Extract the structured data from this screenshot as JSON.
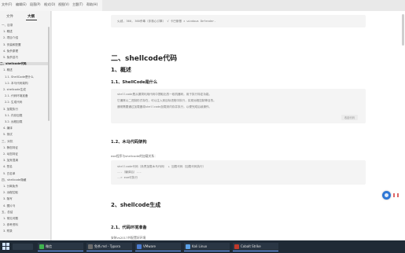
{
  "menubar": {
    "items": [
      "文件(F)",
      "编辑(E)",
      "段落(P)",
      "格式(O)",
      "视图(V)",
      "主题(T)",
      "帮助(H)"
    ]
  },
  "sidebar": {
    "tabs": [
      "文件",
      "大纲"
    ],
    "items": [
      "一、目录",
      "1. 概述",
      "2. 项目介绍",
      "3. 安装和配置",
      "4. 免杀原理",
      "5. 免杀技巧",
      "二、shellcode代码",
      "1. 概述",
      "1.1. ShellCode是什么",
      "1.2. 本马代码架构",
      "2. shellcode生成",
      "2.1. 代码环境准备",
      "2.2. 生成代码",
      "3. 加载执行",
      "3.1. 内存加载",
      "3.2. 远程加载",
      "4. 编译",
      "5. 测试",
      "三、对抗",
      "1. 静态特征",
      "2. 动态特征",
      "3. 加壳混淆",
      "4. 签名",
      "5. 白名单",
      "四、shellcode隐藏",
      "1. 分离免杀",
      "2. 远程拉取",
      "3. 隐写",
      "4. 图片马",
      "五、总结",
      "1. 常见问题",
      "2. 参考资料",
      "3. 附录"
    ]
  },
  "doc": {
    "intro_code": "火绒, 360, 360杀毒（非核心引擎）  √ 卡巴斯基 × windows Defender.",
    "h2_shellcode": "二、shellcode代码",
    "h3_overview": "1、概述",
    "h4_what": "1.1、ShellCode是什么",
    "what_lines": [
      "shellcode是从漏洞利用代码中提取出的一段机器码，用于执行特定功能。",
      "它通常以二进制形式存在，可以注入到目标进程中执行，实现远程控制等目的。",
      "通常需要通过加载器将shellcode加载到内存并执行，以便完成后续操作。"
    ],
    "what_button": "收起代码",
    "h4_arch": "1.2、木马代码架构",
    "arch_text": "exe程序与shellcode的加载关系：",
    "arch_lines": [
      "shellcode代码（负责加载木马代码） + 加载代码（加载代码执行）",
      "---（编译后）---",
      "--> exe可执行"
    ],
    "h3_gen": "2、shellcode生成",
    "h4_env": "2.1、代码环境准备",
    "env_text": "安装vs2017并配置好环境"
  },
  "taskbar": {
    "apps": [
      {
        "label": "微信",
        "color": "#3fb34f"
      },
      {
        "label": "免杀.md - Typora",
        "color": "#6b6b6b"
      },
      {
        "label": "VMware",
        "color": "#4a7bd0"
      },
      {
        "label": "Kali Linux",
        "color": "#5aa0e6"
      },
      {
        "label": "Cobalt Strike",
        "color": "#c0392b"
      }
    ]
  }
}
